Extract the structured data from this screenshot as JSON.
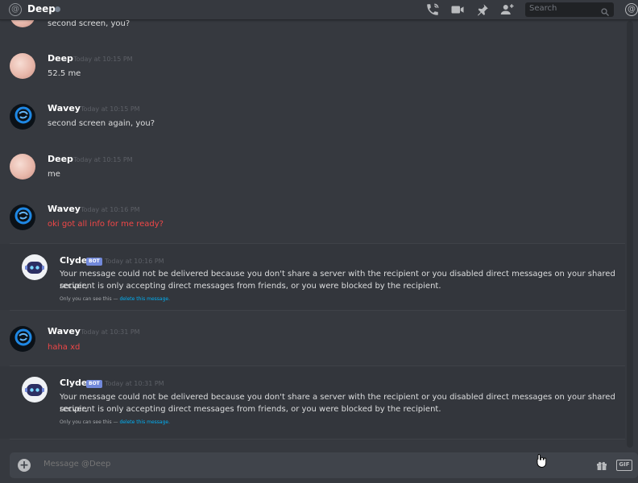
{
  "header": {
    "channel_name": "Deep",
    "search_placeholder": "Search"
  },
  "messages": [
    {
      "text": "second screen, you?"
    },
    {
      "author": "Deep",
      "timestamp": "Today at 10:15 PM",
      "text": "52.5 me"
    },
    {
      "author": "Wavey",
      "timestamp": "Today at 10:15 PM",
      "text": "second screen again, you?"
    },
    {
      "author": "Deep",
      "timestamp": "Today at 10:15 PM",
      "text": "me"
    },
    {
      "author": "Wavey",
      "timestamp": "Today at 10:16 PM",
      "text": "oki got all info for me ready?"
    },
    {
      "author": "Clyde",
      "bot_tag": "BOT",
      "timestamp": "Today at 10:16 PM",
      "line1": "Your message could not be delivered because you don't share a server with the recipient or you disabled direct messages on your shared server,",
      "line2": "recipient is only accepting direct messages from friends, or you were blocked by the recipient.",
      "ephemeral_note": "Only you can see this — ",
      "ephemeral_link": "delete this message."
    },
    {
      "author": "Wavey",
      "timestamp": "Today at 10:31 PM",
      "text": "haha xd"
    },
    {
      "author": "Clyde",
      "bot_tag": "BOT",
      "timestamp": "Today at 10:31 PM",
      "line1": "Your message could not be delivered because you don't share a server with the recipient or you disabled direct messages on your shared server,",
      "line2": "recipient is only accepting direct messages from friends, or you were blocked by the recipient.",
      "ephemeral_note": "Only you can see this — ",
      "ephemeral_link": "delete this message."
    }
  ],
  "composer": {
    "placeholder": "Message @Deep",
    "gif_label": "GIF"
  },
  "colors": {
    "background": "#36393f",
    "bot_tag": "#7289da",
    "error_text": "#f04747",
    "link": "#00b0f4"
  },
  "icons": [
    "at-icon",
    "phone-call-icon",
    "video-icon",
    "pin-icon",
    "add-friend-icon",
    "search-icon",
    "mention-icon",
    "plus-icon",
    "gift-icon"
  ]
}
